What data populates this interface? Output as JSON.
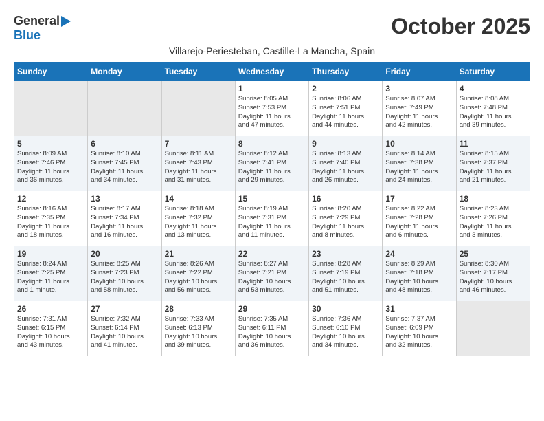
{
  "header": {
    "logo_line1": "General",
    "logo_line2": "Blue",
    "month_title": "October 2025",
    "subtitle": "Villarejo-Periesteban, Castille-La Mancha, Spain"
  },
  "days_of_week": [
    "Sunday",
    "Monday",
    "Tuesday",
    "Wednesday",
    "Thursday",
    "Friday",
    "Saturday"
  ],
  "weeks": [
    [
      {
        "day": "",
        "info": ""
      },
      {
        "day": "",
        "info": ""
      },
      {
        "day": "",
        "info": ""
      },
      {
        "day": "1",
        "info": "Sunrise: 8:05 AM\nSunset: 7:53 PM\nDaylight: 11 hours\nand 47 minutes."
      },
      {
        "day": "2",
        "info": "Sunrise: 8:06 AM\nSunset: 7:51 PM\nDaylight: 11 hours\nand 44 minutes."
      },
      {
        "day": "3",
        "info": "Sunrise: 8:07 AM\nSunset: 7:49 PM\nDaylight: 11 hours\nand 42 minutes."
      },
      {
        "day": "4",
        "info": "Sunrise: 8:08 AM\nSunset: 7:48 PM\nDaylight: 11 hours\nand 39 minutes."
      }
    ],
    [
      {
        "day": "5",
        "info": "Sunrise: 8:09 AM\nSunset: 7:46 PM\nDaylight: 11 hours\nand 36 minutes."
      },
      {
        "day": "6",
        "info": "Sunrise: 8:10 AM\nSunset: 7:45 PM\nDaylight: 11 hours\nand 34 minutes."
      },
      {
        "day": "7",
        "info": "Sunrise: 8:11 AM\nSunset: 7:43 PM\nDaylight: 11 hours\nand 31 minutes."
      },
      {
        "day": "8",
        "info": "Sunrise: 8:12 AM\nSunset: 7:41 PM\nDaylight: 11 hours\nand 29 minutes."
      },
      {
        "day": "9",
        "info": "Sunrise: 8:13 AM\nSunset: 7:40 PM\nDaylight: 11 hours\nand 26 minutes."
      },
      {
        "day": "10",
        "info": "Sunrise: 8:14 AM\nSunset: 7:38 PM\nDaylight: 11 hours\nand 24 minutes."
      },
      {
        "day": "11",
        "info": "Sunrise: 8:15 AM\nSunset: 7:37 PM\nDaylight: 11 hours\nand 21 minutes."
      }
    ],
    [
      {
        "day": "12",
        "info": "Sunrise: 8:16 AM\nSunset: 7:35 PM\nDaylight: 11 hours\nand 18 minutes."
      },
      {
        "day": "13",
        "info": "Sunrise: 8:17 AM\nSunset: 7:34 PM\nDaylight: 11 hours\nand 16 minutes."
      },
      {
        "day": "14",
        "info": "Sunrise: 8:18 AM\nSunset: 7:32 PM\nDaylight: 11 hours\nand 13 minutes."
      },
      {
        "day": "15",
        "info": "Sunrise: 8:19 AM\nSunset: 7:31 PM\nDaylight: 11 hours\nand 11 minutes."
      },
      {
        "day": "16",
        "info": "Sunrise: 8:20 AM\nSunset: 7:29 PM\nDaylight: 11 hours\nand 8 minutes."
      },
      {
        "day": "17",
        "info": "Sunrise: 8:22 AM\nSunset: 7:28 PM\nDaylight: 11 hours\nand 6 minutes."
      },
      {
        "day": "18",
        "info": "Sunrise: 8:23 AM\nSunset: 7:26 PM\nDaylight: 11 hours\nand 3 minutes."
      }
    ],
    [
      {
        "day": "19",
        "info": "Sunrise: 8:24 AM\nSunset: 7:25 PM\nDaylight: 11 hours\nand 1 minute."
      },
      {
        "day": "20",
        "info": "Sunrise: 8:25 AM\nSunset: 7:23 PM\nDaylight: 10 hours\nand 58 minutes."
      },
      {
        "day": "21",
        "info": "Sunrise: 8:26 AM\nSunset: 7:22 PM\nDaylight: 10 hours\nand 56 minutes."
      },
      {
        "day": "22",
        "info": "Sunrise: 8:27 AM\nSunset: 7:21 PM\nDaylight: 10 hours\nand 53 minutes."
      },
      {
        "day": "23",
        "info": "Sunrise: 8:28 AM\nSunset: 7:19 PM\nDaylight: 10 hours\nand 51 minutes."
      },
      {
        "day": "24",
        "info": "Sunrise: 8:29 AM\nSunset: 7:18 PM\nDaylight: 10 hours\nand 48 minutes."
      },
      {
        "day": "25",
        "info": "Sunrise: 8:30 AM\nSunset: 7:17 PM\nDaylight: 10 hours\nand 46 minutes."
      }
    ],
    [
      {
        "day": "26",
        "info": "Sunrise: 7:31 AM\nSunset: 6:15 PM\nDaylight: 10 hours\nand 43 minutes."
      },
      {
        "day": "27",
        "info": "Sunrise: 7:32 AM\nSunset: 6:14 PM\nDaylight: 10 hours\nand 41 minutes."
      },
      {
        "day": "28",
        "info": "Sunrise: 7:33 AM\nSunset: 6:13 PM\nDaylight: 10 hours\nand 39 minutes."
      },
      {
        "day": "29",
        "info": "Sunrise: 7:35 AM\nSunset: 6:11 PM\nDaylight: 10 hours\nand 36 minutes."
      },
      {
        "day": "30",
        "info": "Sunrise: 7:36 AM\nSunset: 6:10 PM\nDaylight: 10 hours\nand 34 minutes."
      },
      {
        "day": "31",
        "info": "Sunrise: 7:37 AM\nSunset: 6:09 PM\nDaylight: 10 hours\nand 32 minutes."
      },
      {
        "day": "",
        "info": ""
      }
    ]
  ]
}
